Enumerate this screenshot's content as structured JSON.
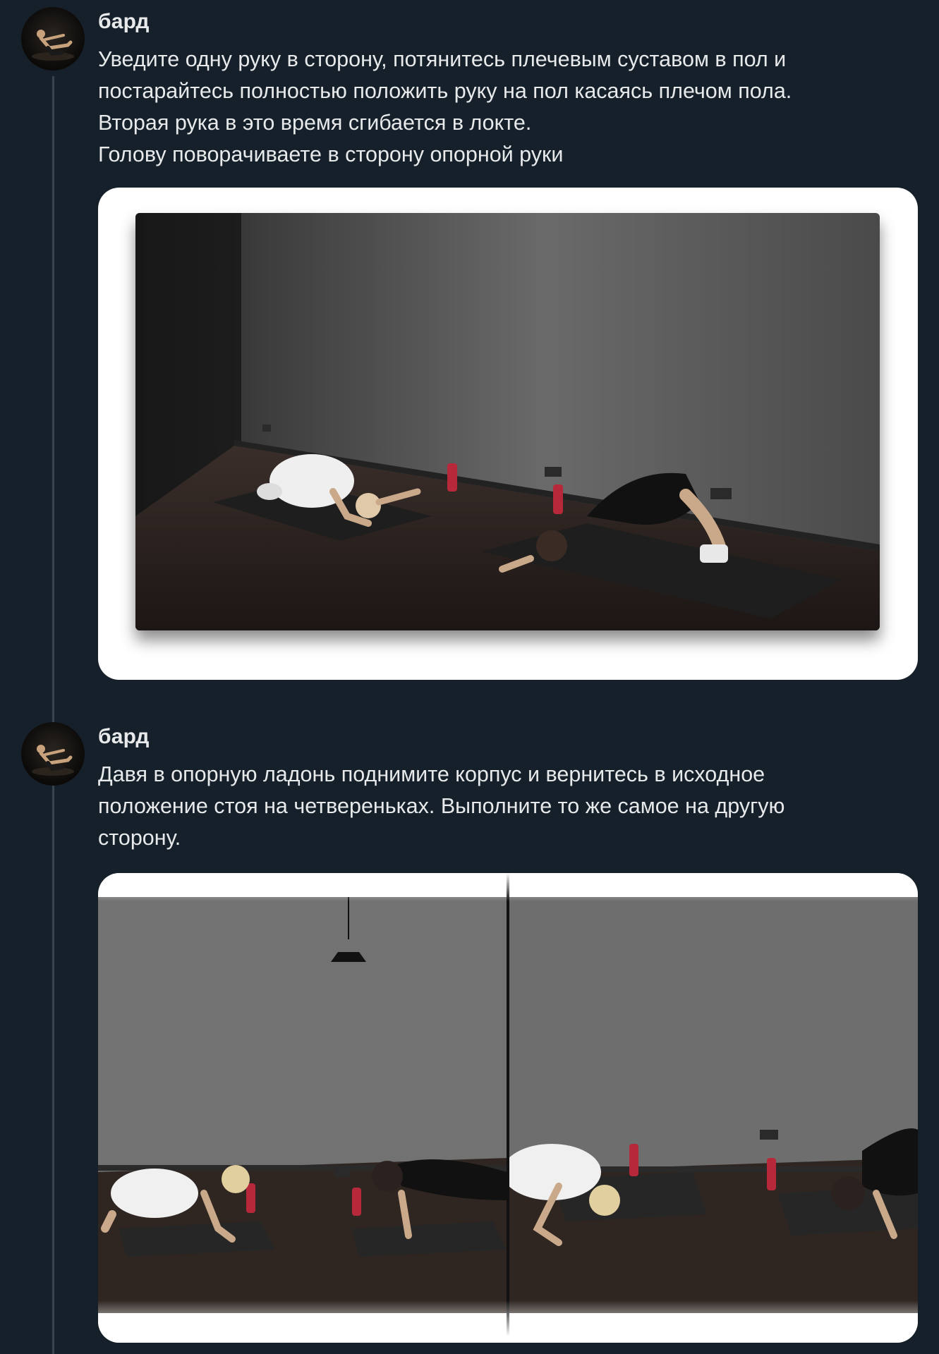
{
  "tweets": [
    {
      "author": "бард",
      "lines": [
        "Уведите одну руку в сторону, потянитесь плечевым суставом в пол и",
        "постарайтесь полностью положить руку на пол касаясь плечом пола.",
        "Вторая рука в это время сгибается в локте.",
        "Голову поворачиваете в сторону опорной руки"
      ]
    },
    {
      "author": "бард",
      "lines": [
        "Давя в опорную ладонь поднимите корпус и вернитесь в исходное",
        "положение стоя на четвереньках. Выполните то же самое на другую",
        "сторону."
      ]
    }
  ],
  "colors": {
    "background": "#15202b",
    "text": "#e7e9ea",
    "thread_line": "#38444d"
  },
  "icons": {
    "avatar": "avatar-icon"
  }
}
